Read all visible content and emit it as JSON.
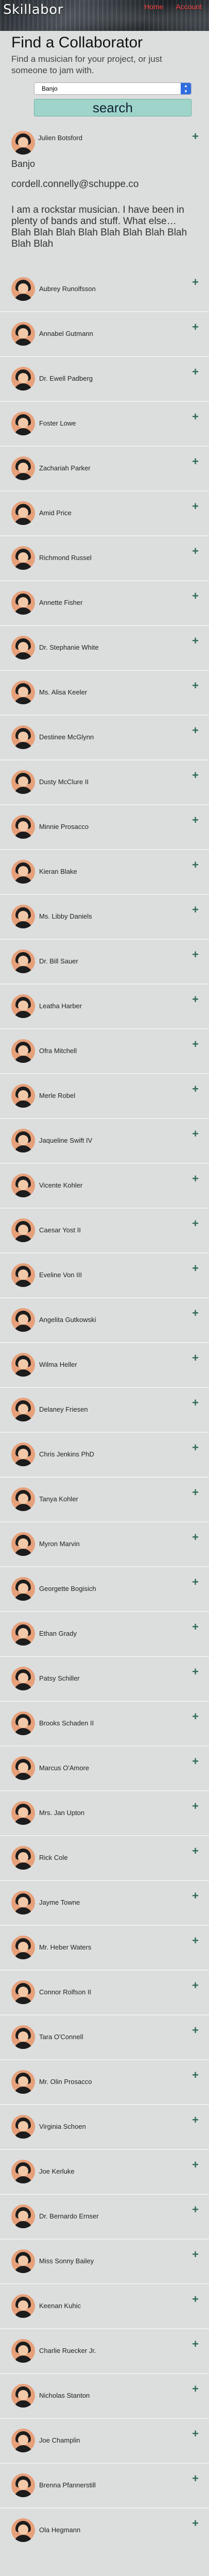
{
  "header": {
    "brand": "Skillabor",
    "nav": [
      {
        "label": "Home"
      },
      {
        "label": "Account"
      }
    ]
  },
  "intro": {
    "title": "Find a Collaborator",
    "subtitle": "Find a musician for your project, or just someone to jam with."
  },
  "search": {
    "selected": "Banjo",
    "button_label": "search"
  },
  "profile": {
    "name": "Julien Botsford",
    "instrument": "Banjo",
    "email": "cordell.connelly@schuppe.co",
    "bio": "I am a rockstar musician. I have been in plenty of bands and stuff. What else… Blah Blah Blah Blah Blah Blah Blah Blah Blah Blah"
  },
  "icons": {
    "add": "plus-icon",
    "avatar": "user-avatar-icon"
  },
  "colors": {
    "accent": "#2e6b52",
    "nav_link": "#ff4a4a",
    "button": "#9fd4ca",
    "avatar_bg": "#e6a07a"
  },
  "musicians": [
    "Aubrey Runolfsson",
    "Annabel Gutmann",
    "Dr. Ewell Padberg",
    "Foster Lowe",
    "Zachariah Parker",
    "Amid Price",
    "Richmond Russel",
    "Annette Fisher",
    "Dr. Stephanie White",
    "Ms. Alisa Keeler",
    "Destinee McGlynn",
    "Dusty McClure II",
    "Minnie Prosacco",
    "Kieran Blake",
    "Ms. Libby Daniels",
    "Dr. Bill Sauer",
    "Leatha Harber",
    "Ofra Mitchell",
    "Merle Robel",
    "Jaqueline Swift IV",
    "Vicente Kohler",
    "Caesar Yost II",
    "Eveline Von III",
    "Angelita Gutkowski",
    "Wilma Heller",
    "Delaney Friesen",
    "Chris Jenkins PhD",
    "Tanya Kohler",
    "Myron Marvin",
    "Georgette Bogisich",
    "Ethan Grady",
    "Patsy Schiller",
    "Brooks Schaden II",
    "Marcus O'Amore",
    "Mrs. Jan Upton",
    "Rick Cole",
    "Jayme Towne",
    "Mr. Heber Waters",
    "Connor Rolfson II",
    "Tara O'Connell",
    "Mr. Olin Prosacco",
    "Virginia Schoen",
    "Joe Kerluke",
    "Dr. Bernardo Ernser",
    "Miss Sonny Bailey",
    "Keenan Kuhic",
    "Charlie Ruecker Jr.",
    "Nicholas Stanton",
    "Joe Champlin",
    "Brenna Pfannerstill",
    "Ola Hegmann"
  ]
}
